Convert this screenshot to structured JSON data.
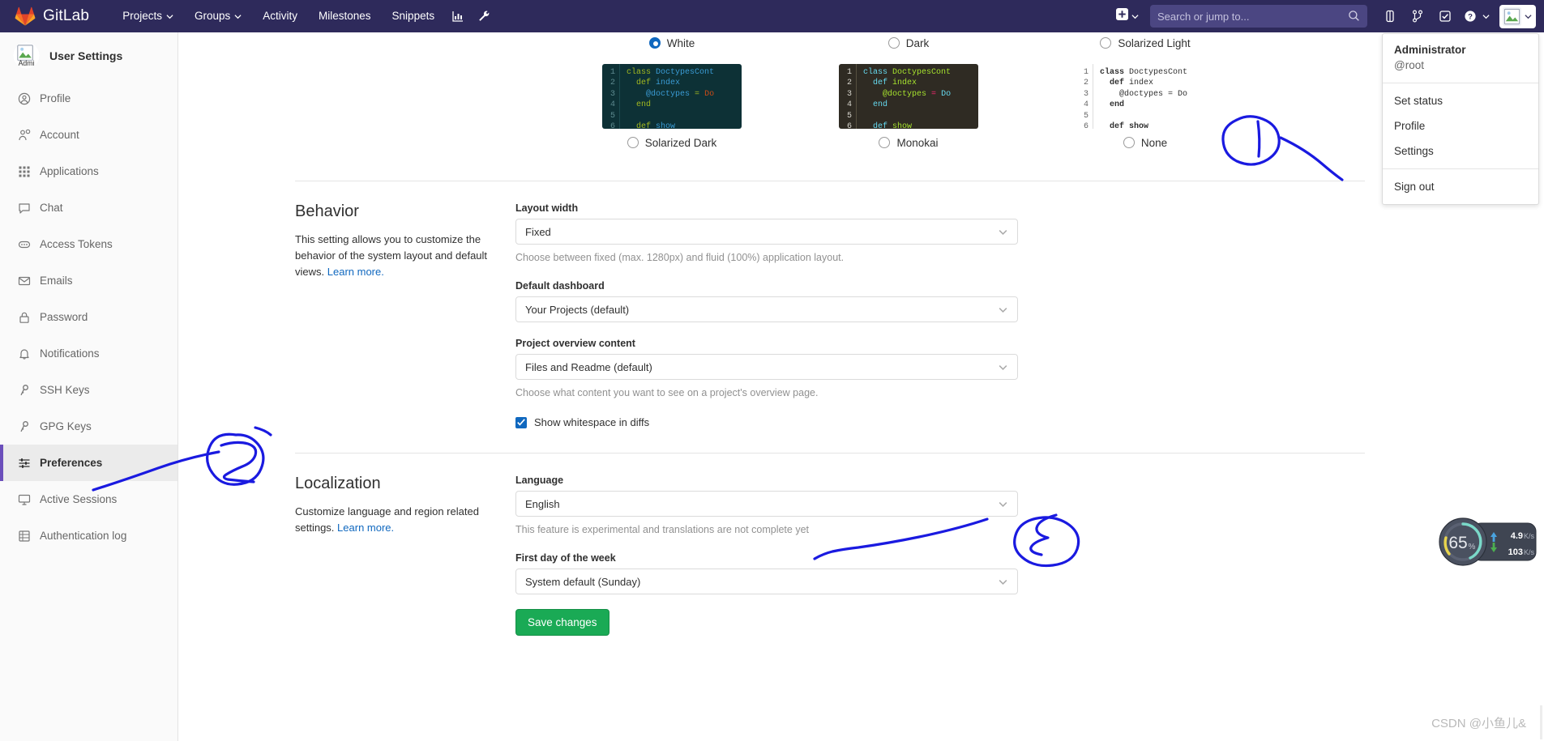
{
  "topnav": {
    "brand": "GitLab",
    "links": [
      {
        "label": "Projects",
        "caret": true,
        "icon": ""
      },
      {
        "label": "Groups",
        "caret": true,
        "icon": ""
      },
      {
        "label": "Activity",
        "caret": false,
        "icon": ""
      },
      {
        "label": "Milestones",
        "caret": false,
        "icon": ""
      },
      {
        "label": "Snippets",
        "caret": false,
        "icon": ""
      }
    ],
    "icon_buttons": [
      {
        "name": "analytics-icon"
      },
      {
        "name": "wrench-icon"
      }
    ],
    "create_new_label": "",
    "search": {
      "placeholder": "Search or jump to...",
      "value": ""
    },
    "right_icons": [
      {
        "name": "issues-icon"
      },
      {
        "name": "merge-request-icon"
      },
      {
        "name": "todos-icon"
      },
      {
        "name": "help-icon"
      }
    ],
    "brand_color": "#2e2a5b",
    "search_bg": "#4b4682"
  },
  "user_menu": {
    "name": "Administrator",
    "handle": "@root",
    "items_group1": [
      "Set status",
      "Profile",
      "Settings"
    ],
    "items_group2": [
      "Sign out"
    ]
  },
  "sidebar": {
    "title": "User Settings",
    "avatar_caption": "Admi",
    "items": [
      {
        "label": "Profile",
        "icon": "user-circle-icon",
        "active": false
      },
      {
        "label": "Account",
        "icon": "account-gear-icon",
        "active": false
      },
      {
        "label": "Applications",
        "icon": "applications-grid-icon",
        "active": false
      },
      {
        "label": "Chat",
        "icon": "chat-bubble-icon",
        "active": false
      },
      {
        "label": "Access Tokens",
        "icon": "token-icon",
        "active": false
      },
      {
        "label": "Emails",
        "icon": "envelope-icon",
        "active": false
      },
      {
        "label": "Password",
        "icon": "lock-icon",
        "active": false
      },
      {
        "label": "Notifications",
        "icon": "bell-icon",
        "active": false
      },
      {
        "label": "SSH Keys",
        "icon": "key-icon",
        "active": false
      },
      {
        "label": "GPG Keys",
        "icon": "key-icon",
        "active": false
      },
      {
        "label": "Preferences",
        "icon": "sliders-icon",
        "active": true
      },
      {
        "label": "Active Sessions",
        "icon": "monitor-icon",
        "active": false
      },
      {
        "label": "Authentication log",
        "icon": "log-grid-icon",
        "active": false
      }
    ],
    "active_accent": "#6b4fbb"
  },
  "syntax_themes": {
    "options": [
      {
        "label": "White",
        "selected": true,
        "style": "none",
        "position": "top"
      },
      {
        "label": "Dark",
        "selected": false,
        "style": "none",
        "position": "top"
      },
      {
        "label": "Solarized Light",
        "selected": false,
        "style": "none",
        "position": "top"
      },
      {
        "label": "Solarized Dark",
        "selected": false,
        "style": "dark",
        "position": "bottom"
      },
      {
        "label": "Monokai",
        "selected": false,
        "style": "mono",
        "position": "bottom"
      },
      {
        "label": "None",
        "selected": false,
        "style": "none",
        "position": "bottom"
      }
    ],
    "code_lines": [
      "1",
      "2",
      "3",
      "4",
      "5",
      "6"
    ],
    "code_text": [
      "class DoctypesCont",
      "  def index",
      "    @doctypes = Do",
      "  end",
      "",
      "  def show"
    ]
  },
  "behavior": {
    "title": "Behavior",
    "description": "This setting allows you to customize the behavior of the system layout and default views.",
    "learn_more": "Learn more.",
    "fields": [
      {
        "label": "Layout width",
        "value": "Fixed",
        "help": "Choose between fixed (max. 1280px) and fluid (100%) application layout."
      },
      {
        "label": "Default dashboard",
        "value": "Your Projects (default)",
        "help": ""
      },
      {
        "label": "Project overview content",
        "value": "Files and Readme (default)",
        "help": "Choose what content you want to see on a project's overview page."
      }
    ],
    "checkbox_label": "Show whitespace in diffs",
    "checkbox_checked": true
  },
  "localization": {
    "title": "Localization",
    "description": "Customize language and region related settings.",
    "learn_more": "Learn more.",
    "fields": [
      {
        "label": "Language",
        "value": "English",
        "help": "This feature is experimental and translations are not complete yet"
      },
      {
        "label": "First day of the week",
        "value": "System default (Sunday)",
        "help": ""
      }
    ],
    "save_label": "Save changes"
  },
  "annotations": [
    {
      "number": "1",
      "target": "settings-menu-item"
    },
    {
      "number": "2",
      "target": "preferences-sidebar-item"
    },
    {
      "number": "3",
      "target": "language-select"
    }
  ],
  "network_widget": {
    "percent": "65",
    "percent_unit": "%",
    "upload": "4.9",
    "upload_unit": "K/s",
    "download": "103",
    "download_unit": "K/s",
    "up_color": "#4aa3df",
    "down_color": "#4caf50"
  },
  "watermark": "CSDN @小鱼儿&"
}
